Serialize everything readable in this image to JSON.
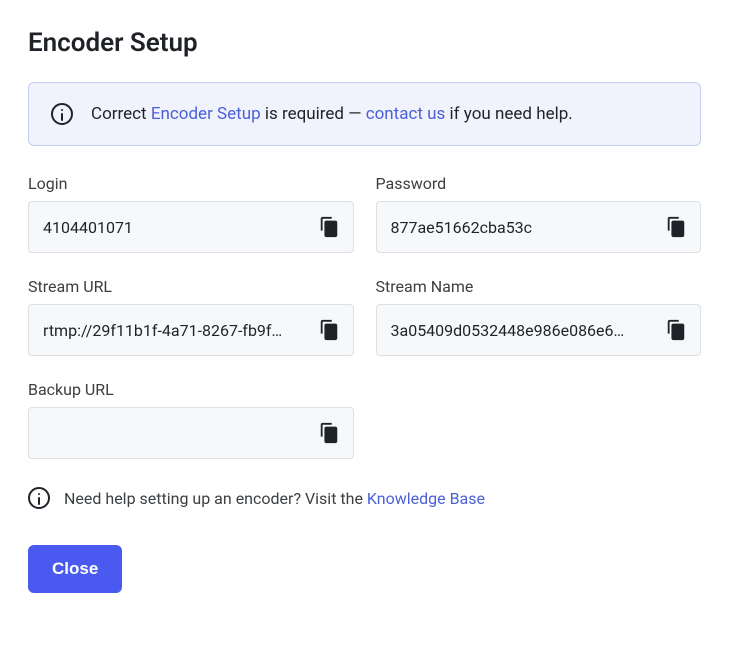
{
  "title": "Encoder Setup",
  "banner": {
    "pre": "Correct ",
    "link1": "Encoder Setup",
    "mid": " is required — ",
    "link2": "contact us",
    "post": " if you need help."
  },
  "fields": {
    "login": {
      "label": "Login",
      "value": "4104401071"
    },
    "password": {
      "label": "Password",
      "value": "877ae51662cba53c"
    },
    "stream_url": {
      "label": "Stream URL",
      "value": "rtmp://29f11b1f-4a71-8267-fb9f…"
    },
    "stream_name": {
      "label": "Stream Name",
      "value": "3a05409d0532448e986e086e6…"
    },
    "backup_url": {
      "label": "Backup URL",
      "value": ""
    }
  },
  "help": {
    "text": "Need help setting up an encoder? Visit the ",
    "link": "Knowledge Base"
  },
  "buttons": {
    "close": "Close"
  }
}
